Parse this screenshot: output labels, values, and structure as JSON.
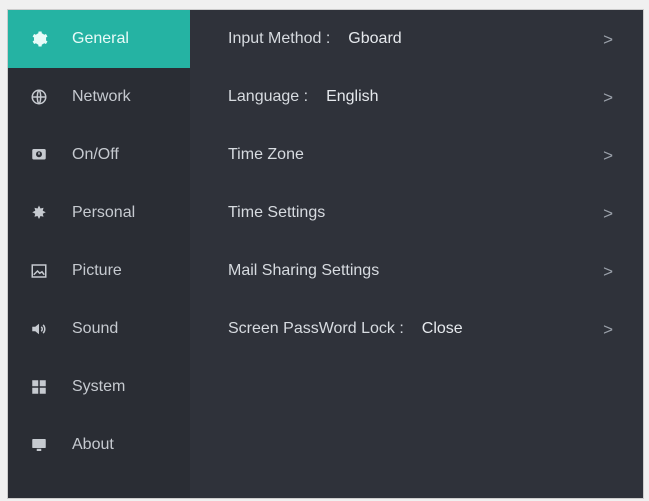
{
  "sidebar": {
    "items": [
      {
        "label": "General",
        "icon": "gear-icon"
      },
      {
        "label": "Network",
        "icon": "network-icon"
      },
      {
        "label": "On/Off",
        "icon": "power-schedule-icon"
      },
      {
        "label": "Personal",
        "icon": "person-icon"
      },
      {
        "label": "Picture",
        "icon": "picture-icon"
      },
      {
        "label": "Sound",
        "icon": "speaker-icon"
      },
      {
        "label": "System",
        "icon": "system-icon"
      },
      {
        "label": "About",
        "icon": "about-monitor-icon"
      }
    ]
  },
  "general": {
    "rows": [
      {
        "label": "Input Method :",
        "value": "Gboard"
      },
      {
        "label": "Language :",
        "value": "English"
      },
      {
        "label": "Time Zone",
        "value": ""
      },
      {
        "label": "Time Settings",
        "value": ""
      },
      {
        "label": "Mail Sharing Settings",
        "value": ""
      },
      {
        "label": "Screen PassWord Lock :",
        "value": "Close"
      }
    ],
    "chevron": ">"
  },
  "colors": {
    "accent": "#25b3a3",
    "background": "#2f323a",
    "sidebar": "#2a2d34"
  }
}
